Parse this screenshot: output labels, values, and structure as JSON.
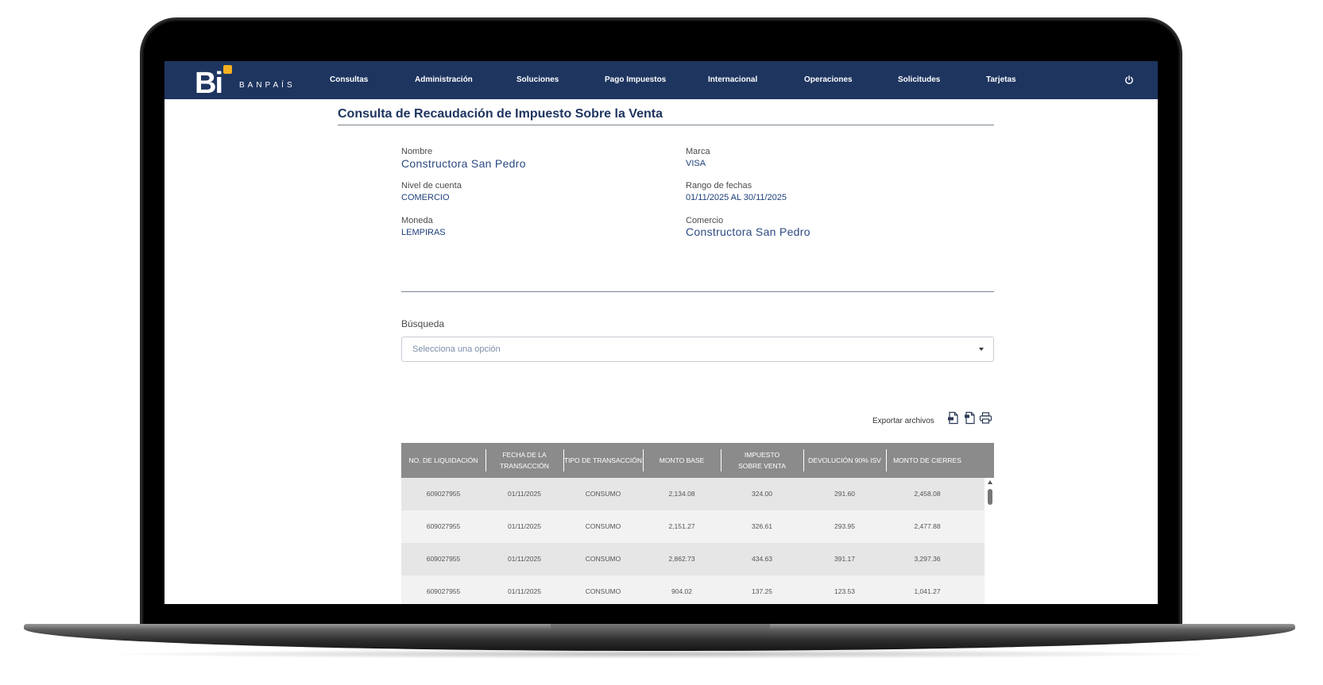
{
  "brand": {
    "logo_mark": "Bi",
    "logo_text": "BANPAÍS",
    "accent_color": "#f5b120",
    "nav_color": "#1e3560"
  },
  "nav": {
    "items": [
      "Consultas",
      "Administración",
      "Soluciones",
      "Pago Impuestos",
      "Internacional",
      "Operaciones",
      "Solicitudes",
      "Tarjetas"
    ],
    "power_icon": "power-icon"
  },
  "page": {
    "title": "Consulta de Recaudación de Impuesto Sobre la Venta"
  },
  "details": {
    "nombre_label": "Nombre",
    "nombre_value": "Constructora San Pedro",
    "marca_label": "Marca",
    "marca_value": "VISA",
    "nivel_label": "Nivel de cuenta",
    "nivel_value": "COMERCIO",
    "rango_label": "Rango de fechas",
    "rango_value": "01/11/2025 AL 30/11/2025",
    "moneda_label": "Moneda",
    "moneda_value": "LEMPIRAS",
    "comercio_label": "Comercio",
    "comercio_value": "Constructora San Pedro"
  },
  "search": {
    "label": "Búsqueda",
    "placeholder": "Selecciona una opción"
  },
  "export": {
    "label": "Exportar archivos",
    "icons": [
      "pdf-file-icon",
      "excel-file-icon",
      "print-icon"
    ]
  },
  "table": {
    "headers": [
      "NO. DE LIQUIDACIÓN",
      "FECHA DE LA TRANSACCIÓN",
      "TIPO DE TRANSACCIÓN",
      "MONTO BASE",
      "IMPUESTO SOBRE VENTA",
      "DEVOLUCIÓN 90% ISV",
      "MONTO DE CIERRES"
    ],
    "rows": [
      [
        "609027955",
        "01/11/2025",
        "CONSUMO",
        "2,134.08",
        "324.00",
        "291.60",
        "2,458.08"
      ],
      [
        "609027955",
        "01/11/2025",
        "CONSUMO",
        "2,151.27",
        "326.61",
        "293.95",
        "2,477.88"
      ],
      [
        "609027955",
        "01/11/2025",
        "CONSUMO",
        "2,862.73",
        "434.63",
        "391.17",
        "3,297.36"
      ],
      [
        "609027955",
        "01/11/2025",
        "CONSUMO",
        "904.02",
        "137.25",
        "123.53",
        "1,041.27"
      ]
    ]
  }
}
